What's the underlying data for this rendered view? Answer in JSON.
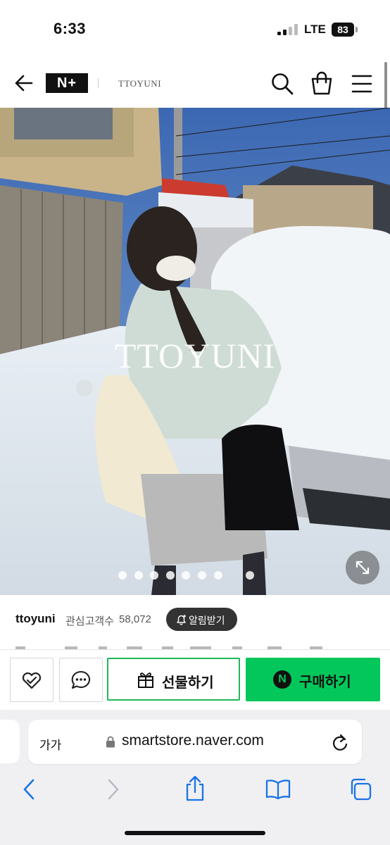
{
  "status_bar": {
    "time": "6:33",
    "network": "LTE",
    "battery": "83"
  },
  "header": {
    "logo": "N+",
    "store_name": "TTOYUNI",
    "icons": [
      "back-arrow-icon",
      "search-icon",
      "cart-icon",
      "menu-icon"
    ]
  },
  "product": {
    "watermark": "TTOYUNI",
    "image_count": 9,
    "active_image": 8
  },
  "store": {
    "id": "ttoyuni",
    "follower_label": "관심고객수",
    "follower_count": "58,072",
    "alarm_label": "알림받기"
  },
  "actions": {
    "gift_label": "선물하기",
    "buy_label": "구매하기",
    "buy_icon_letter": "N"
  },
  "browser": {
    "text_size": "가가",
    "url": "smartstore.naver.com"
  },
  "colors": {
    "naver_green": "#03c75a",
    "gift_border": "#1fb858",
    "dark_button": "#333333"
  }
}
